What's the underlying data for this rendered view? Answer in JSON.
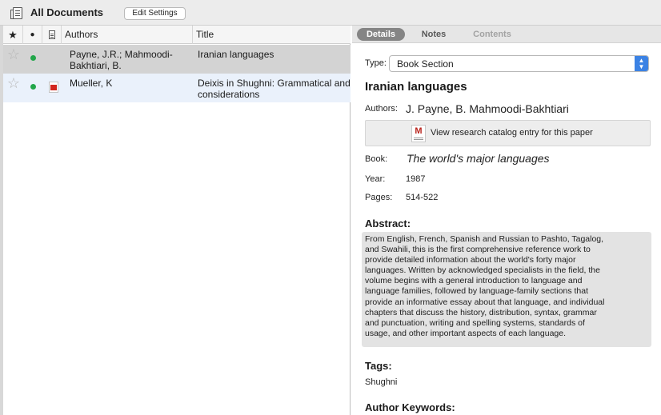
{
  "toolbar": {
    "title": "All Documents",
    "edit_settings_label": "Edit Settings"
  },
  "columns": {
    "star": "★",
    "read": "●",
    "authors": "Authors",
    "title": "Title"
  },
  "rows": [
    {
      "starred": false,
      "unread": true,
      "has_pdf": false,
      "authors_line1": "Payne, J.R.; Mahmoodi-",
      "authors_line2": "Bakhtiari, B.",
      "title_line1": "Iranian languages",
      "title_line2": ""
    },
    {
      "starred": false,
      "unread": true,
      "has_pdf": true,
      "authors_line1": "Mueller, K",
      "authors_line2": "",
      "title_line1": "Deixis in Shughni: Grammatical and",
      "title_line2": "considerations"
    }
  ],
  "tabs": {
    "details": "Details",
    "notes": "Notes",
    "contents": "Contents",
    "active": "Details"
  },
  "details": {
    "type_label": "Type:",
    "type_value": "Book Section",
    "title": "Iranian languages",
    "authors_label": "Authors:",
    "authors_value": "J. Payne, B. Mahmoodi-Bakhtiari",
    "catalog_link": "View research catalog entry for this paper",
    "book_label": "Book:",
    "book_value": "The world's major languages",
    "year_label": "Year:",
    "year_value": "1987",
    "pages_label": "Pages:",
    "pages_value": "514-522",
    "abstract_heading": "Abstract:",
    "abstract_lines": [
      "From English, French, Spanish and Russian to Pashto, Tagalog,",
      "and Swahili, this is the first comprehensive reference work to",
      "provide detailed information about the world's forty major",
      "languages. Written by acknowledged specialists in the field, the",
      "volume begins with a general introduction to language and",
      "language families, followed by language-family sections that",
      "provide an informative essay about that language, and individual",
      "chapters that discuss the history, distribution, syntax, grammar",
      "and punctuation, writing and spelling systems, standards of",
      "usage, and other important aspects of each language."
    ],
    "tags_heading": "Tags:",
    "tags_value": "Shughni",
    "keywords_heading": "Author Keywords:"
  },
  "icons": {
    "library": "library-icon",
    "star": "star-outline-icon",
    "unread": "green-dot-icon",
    "pdf": "pdf-icon",
    "catalog": "mendeley-catalog-icon",
    "select_arrows": "select-arrows-icon"
  },
  "colors": {
    "selected_row": "#d3d3d3",
    "alt_row": "#eaf1fb",
    "unread_dot": "#22a64a",
    "pdf_red": "#d2261f",
    "select_blue": "#3b82e4",
    "active_tab": "#858585",
    "abstract_bg": "#e3e3e3"
  }
}
